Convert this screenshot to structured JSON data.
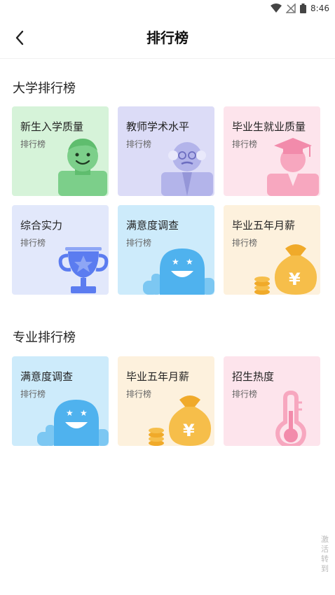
{
  "status_bar": {
    "time": "8:46",
    "icons": [
      "wifi-icon",
      "no-signal-icon",
      "battery-icon"
    ]
  },
  "nav": {
    "title": "排行榜",
    "back_icon": "chevron-left-icon"
  },
  "sections": [
    {
      "title": "大学排行榜",
      "cards": [
        {
          "title": "新生入学质量",
          "subtitle": "排行榜",
          "icon": "student-icon",
          "bg": "#d6f3d9"
        },
        {
          "title": "教师学术水平",
          "subtitle": "排行榜",
          "icon": "professor-icon",
          "bg": "#dcdcf7"
        },
        {
          "title": "毕业生就业质量",
          "subtitle": "排行榜",
          "icon": "graduate-icon",
          "bg": "#fde4ec"
        },
        {
          "title": "综合实力",
          "subtitle": "排行榜",
          "icon": "trophy-icon",
          "bg": "#e2e8fb"
        },
        {
          "title": "满意度调查",
          "subtitle": "排行榜",
          "icon": "happy-ghost-icon",
          "bg": "#cdebfb"
        },
        {
          "title": "毕业五年月薪",
          "subtitle": "排行榜",
          "icon": "money-bag-icon",
          "bg": "#fdf1dd"
        }
      ]
    },
    {
      "title": "专业排行榜",
      "cards": [
        {
          "title": "满意度调查",
          "subtitle": "排行榜",
          "icon": "happy-ghost-icon",
          "bg": "#cdebfb"
        },
        {
          "title": "毕业五年月薪",
          "subtitle": "排行榜",
          "icon": "money-bag-icon",
          "bg": "#fdf1dd"
        },
        {
          "title": "招生热度",
          "subtitle": "排行榜",
          "icon": "thermometer-icon",
          "bg": "#fde4ec"
        }
      ]
    }
  ],
  "watermark": "激活 转到",
  "colors": {
    "green": "#7ccf8a",
    "purple": "#b3b4ea",
    "pink": "#f7a7bf",
    "blue": "#5b7cf0",
    "cyan": "#4fb2ee",
    "gold": "#f6be4a"
  }
}
